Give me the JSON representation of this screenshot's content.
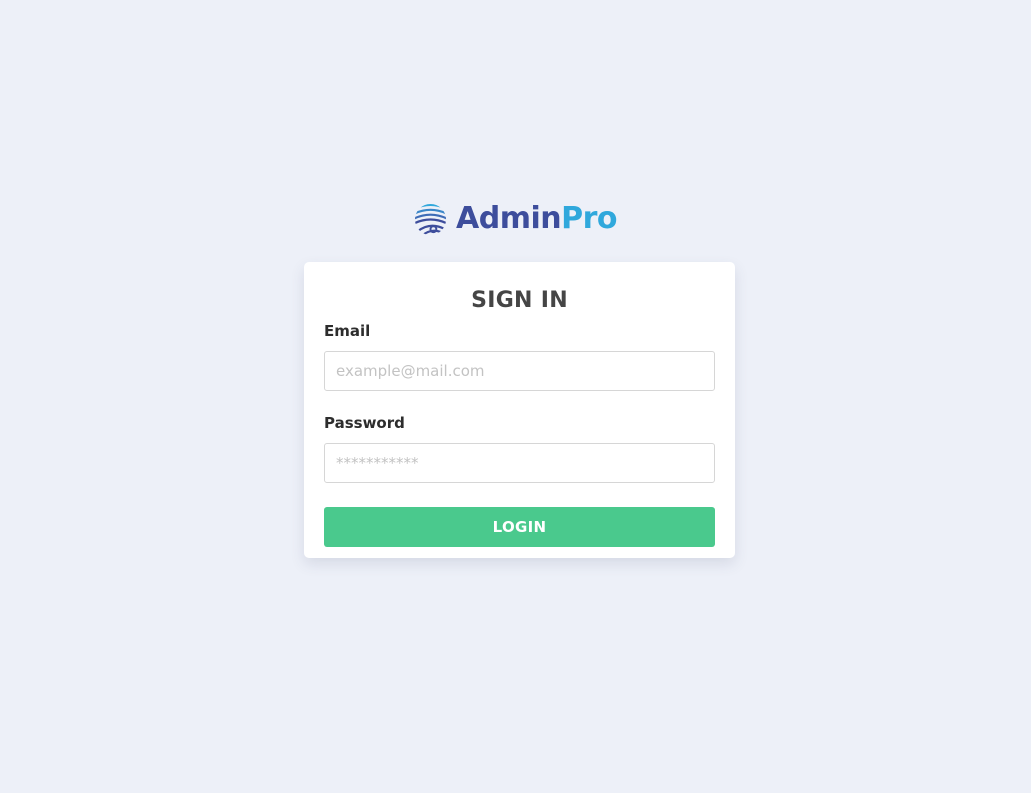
{
  "brand": {
    "name_part1": "Admin",
    "name_part2": "Pro",
    "logo_icon": "globe-swirl-icon",
    "colors": {
      "primary": "#3d4d9c",
      "accent": "#30a8dc"
    }
  },
  "login_form": {
    "title": "SIGN IN",
    "email": {
      "label": "Email",
      "value": "",
      "placeholder": "example@mail.com"
    },
    "password": {
      "label": "Password",
      "value": "",
      "placeholder": "***********"
    },
    "submit_label": "LOGIN",
    "submit_color": "#4ac98d"
  },
  "background_color": "#edf0f8"
}
